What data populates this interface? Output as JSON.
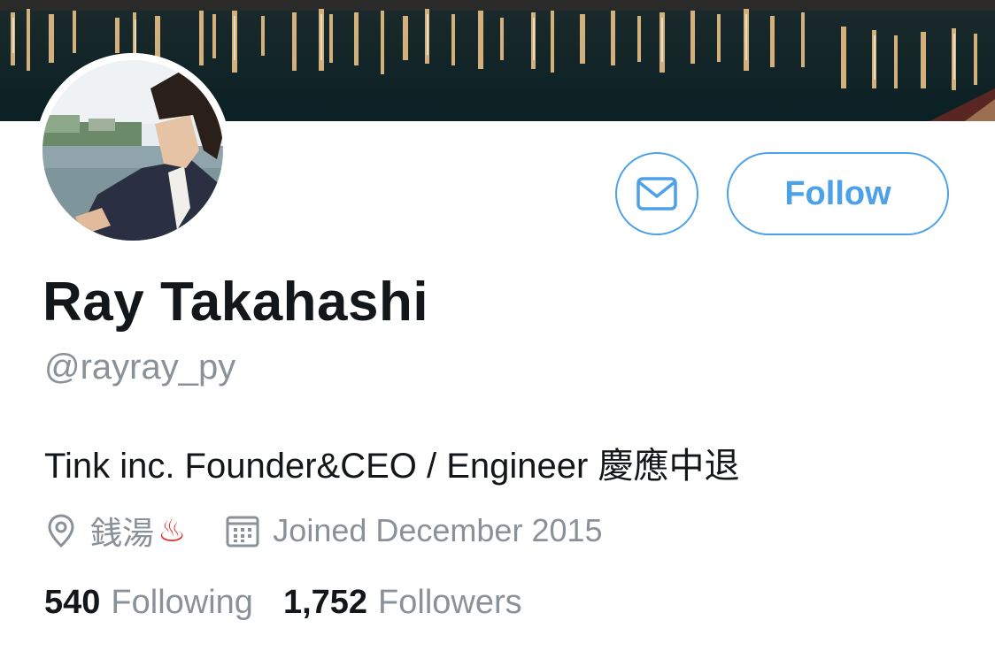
{
  "profile": {
    "display_name": "Ray Takahashi",
    "handle": "@rayray_py",
    "bio": "Tink inc. Founder&CEO / Engineer 慶應中退",
    "location": "銭湯",
    "location_emoji": "♨",
    "joined": "Joined December 2015"
  },
  "actions": {
    "message_icon": "envelope-icon",
    "follow_label": "Follow"
  },
  "stats": {
    "following_count": "540",
    "following_label": "Following",
    "followers_count": "1,752",
    "followers_label": "Followers"
  },
  "icons": {
    "location": "location-pin-icon",
    "calendar": "calendar-icon"
  },
  "colors": {
    "accent": "#4ca1e8",
    "text_primary": "#14171a",
    "text_secondary": "#8a9199",
    "hot_spring": "#e0312b"
  }
}
